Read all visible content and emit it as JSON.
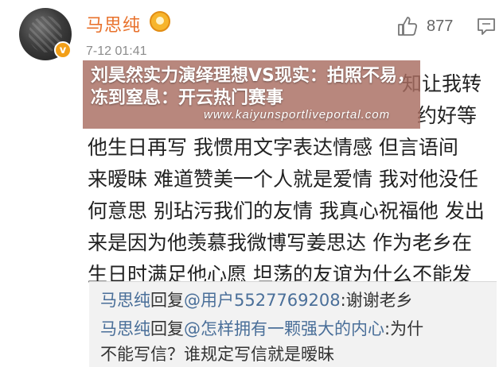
{
  "post": {
    "username": "马思纯",
    "time": "7-12 01:41",
    "likes": "877",
    "body_lines": [
      "知让我转",
      "约好等",
      "他生日再写 我惯用文字表达情感 但言语间",
      "来暧昧 难道赞美一个人就是爱情 我对他没任",
      "何意思 别玷污我们的友情 我真心祝福他 发出",
      "来是因为他羡慕我微博写姜思达 作为老乡在",
      "生日时满足他心愿 坦荡的友谊为什么不能发"
    ],
    "icons": {
      "like": "thumbs-up-icon",
      "comment": "comment-icon",
      "verified": "verified-badge-icon",
      "vip": "vip-medal-icon"
    }
  },
  "banner": {
    "title": "刘昊然实力演绎理想VS现实：拍照不易，冻到窒息：开云热门赛事",
    "url": "www.kaiyunsportliveportal.com"
  },
  "replies": [
    {
      "name": "马思纯",
      "action": "回复",
      "mention": "@用户5527769208",
      "text": ":谢谢老乡"
    },
    {
      "name": "马思纯",
      "action": "回复",
      "mention": "@怎样拥有一颗强大的内心",
      "text": ":为什"
    },
    {
      "continuation": "不能写信？谁规定写信就是暧昧"
    }
  ]
}
